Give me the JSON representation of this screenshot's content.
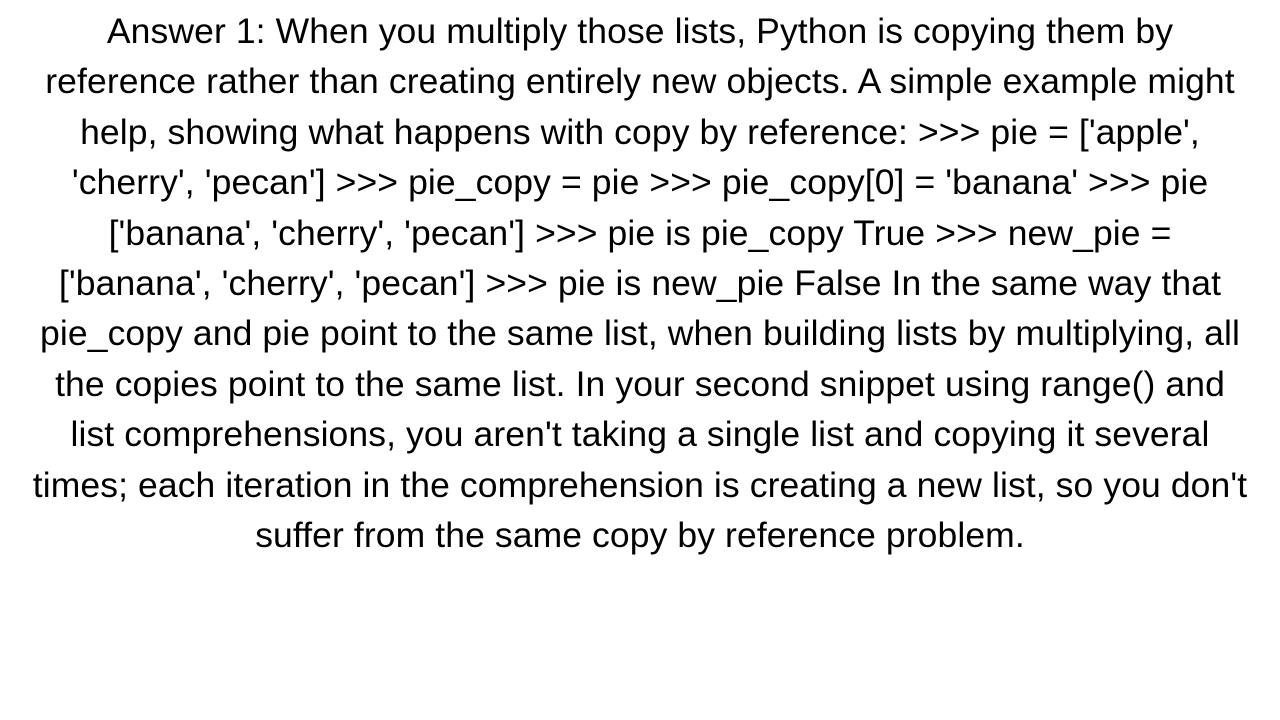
{
  "answer": {
    "text": "Answer 1: When you multiply those lists, Python is copying them by reference rather than creating entirely new objects. A simple example might help, showing what happens with copy by reference: >>> pie = ['apple', 'cherry', 'pecan'] >>> pie_copy = pie >>> pie_copy[0] = 'banana' >>> pie ['banana', 'cherry', 'pecan'] >>> pie is pie_copy True >>> new_pie = ['banana', 'cherry', 'pecan'] >>> pie is new_pie False  In the same way that pie_copy and pie point to the same list, when building lists by multiplying, all the copies point to the same list. In your second snippet using range() and list comprehensions, you aren't taking a single list and copying it several times; each iteration in the comprehension is creating a new list, so you don't suffer from the same copy by reference problem."
  }
}
